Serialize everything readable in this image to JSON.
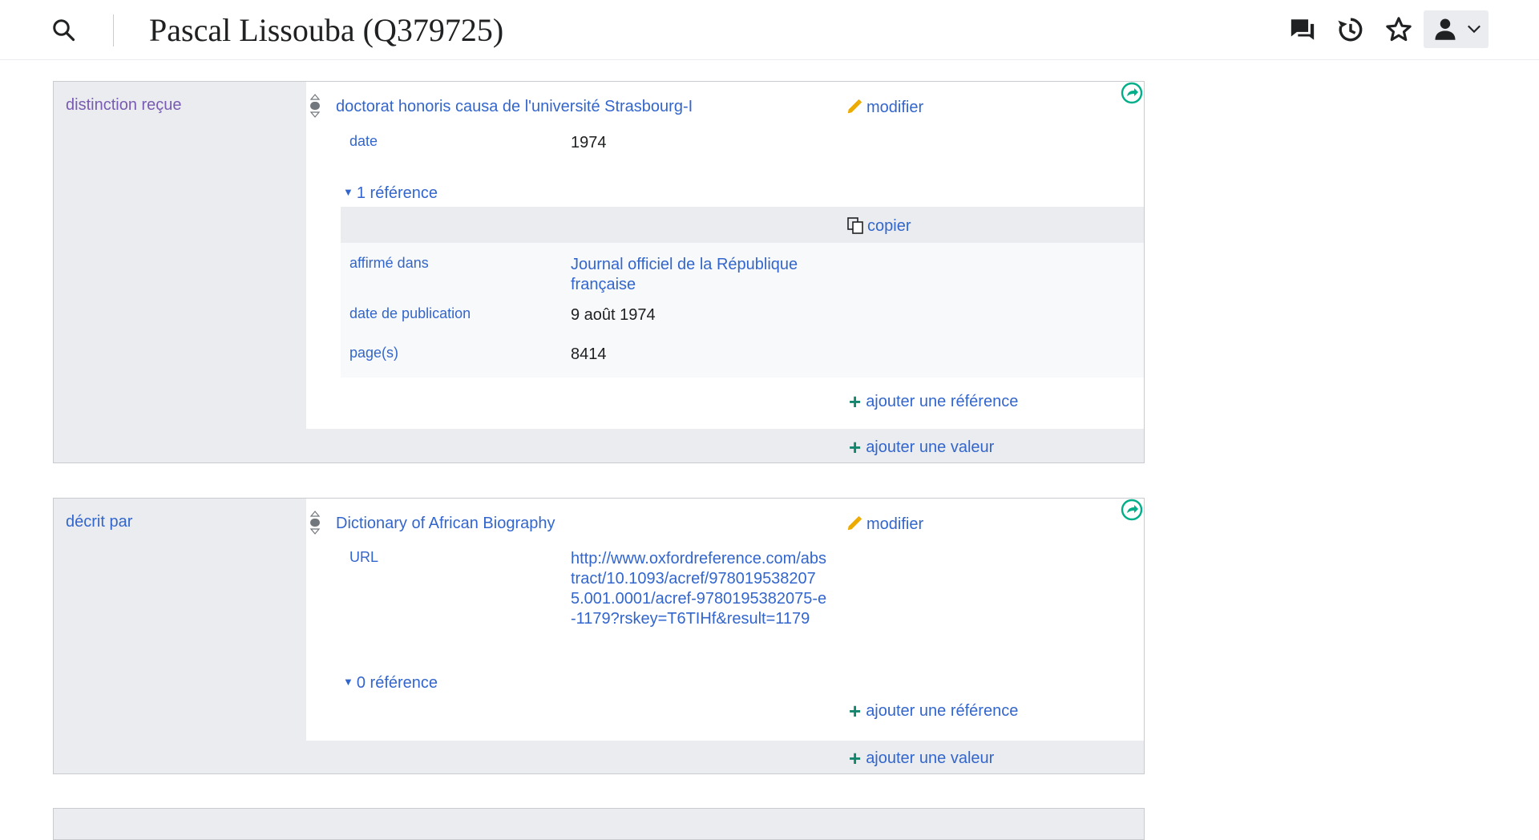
{
  "header": {
    "title": "Pascal Lissouba (Q379725)"
  },
  "icons": {
    "search": "search-icon",
    "talk": "talk-icon",
    "history": "history-icon",
    "watch": "star-icon",
    "user": "user-icon",
    "dropdown": "chevron-down-icon"
  },
  "groups": [
    {
      "property": "distinction reçue",
      "value": "doctorat honoris causa de l'université Strasbourg-I",
      "edit_label": "modifier",
      "qualifiers": [
        {
          "label": "date",
          "value": "1974"
        }
      ],
      "references_toggle": "1 référence",
      "reference": {
        "copy_label": "copier",
        "rows": [
          {
            "label": "affirmé dans",
            "value": "Journal officiel de la République française"
          },
          {
            "label": "date de publication",
            "value": "9 août 1974"
          },
          {
            "label": "page(s)",
            "value": "8414"
          }
        ]
      },
      "add_reference": "ajouter une référence",
      "add_value": "ajouter une valeur"
    },
    {
      "property": "décrit par",
      "value": "Dictionary of African Biography",
      "edit_label": "modifier",
      "qualifiers": [
        {
          "label": "URL",
          "value": "http://www.oxfordreference.com/abstract/10.1093/acref/9780195382075.001.0001/acref-9780195382075-e-1179?rskey=T6TIHf&result=1179"
        }
      ],
      "references_toggle": "0 référence",
      "add_reference": "ajouter une référence",
      "add_value": "ajouter une valeur"
    }
  ],
  "colors": {
    "link": "#3366cc",
    "visited": "#795cb2",
    "add_green": "#14866d",
    "pencil": "#edab00",
    "share_green": "#00af89"
  }
}
